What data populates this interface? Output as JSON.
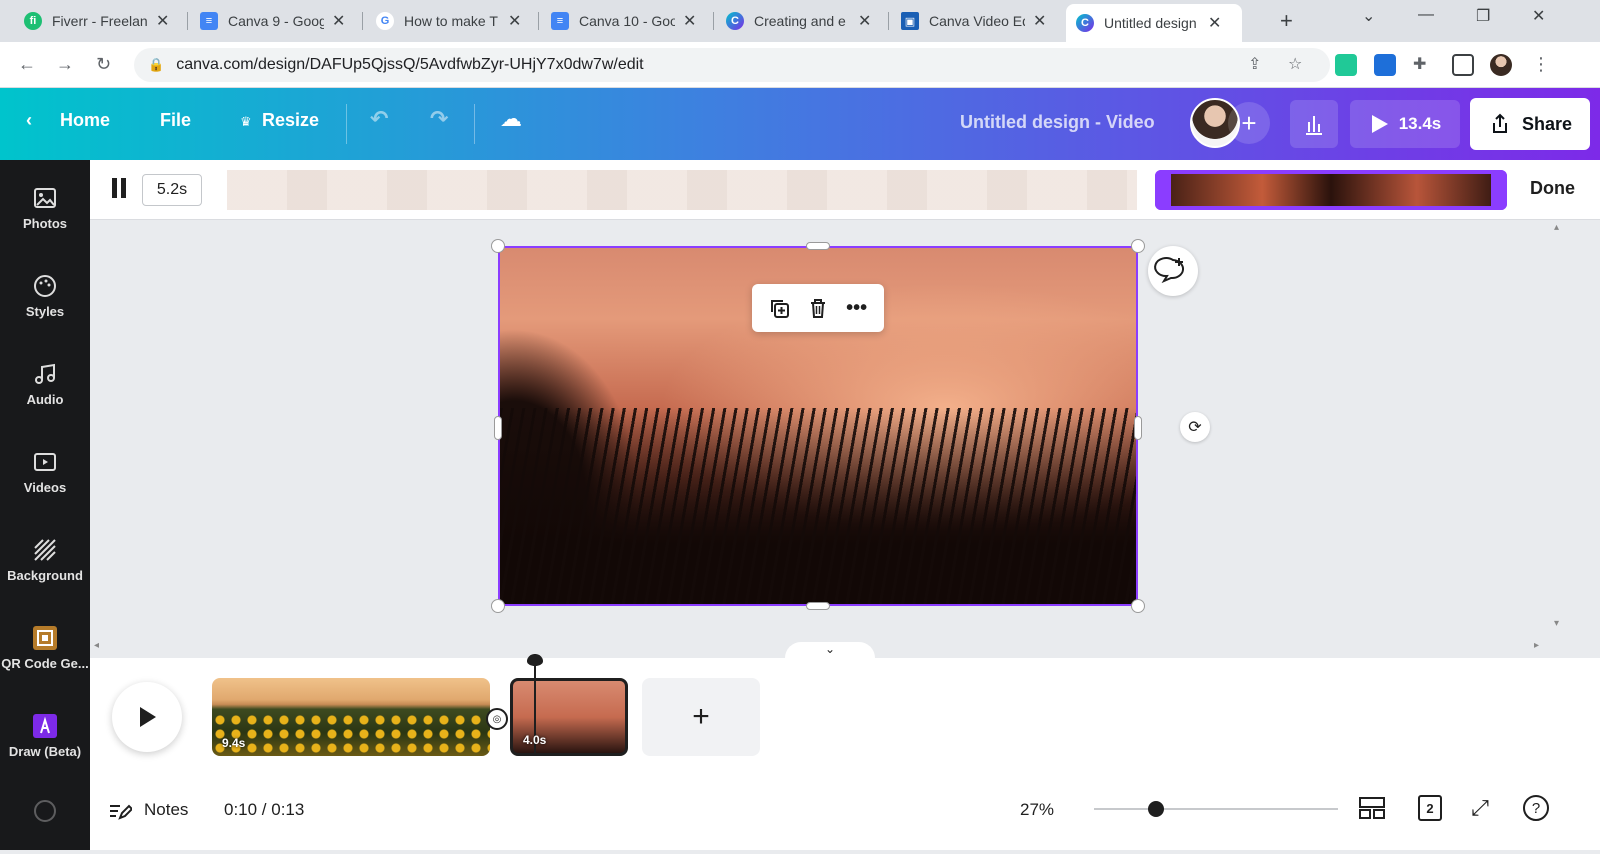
{
  "browser": {
    "tabs": [
      {
        "title": "Fiverr - Freelance",
        "color": "#1dbf73",
        "glyph": "fi"
      },
      {
        "title": "Canva 9 - Google",
        "color": "#4285f4",
        "glyph": "≡"
      },
      {
        "title": "How to make T",
        "color": "#ffffff",
        "glyph": "G"
      },
      {
        "title": "Canva 10 - Goo",
        "color": "#4285f4",
        "glyph": "≡"
      },
      {
        "title": "Creating and e",
        "color": "#7d2ae8",
        "glyph": "C"
      },
      {
        "title": "Canva Video Ed",
        "color": "#1a5fb4",
        "glyph": "▣"
      },
      {
        "title": "Untitled design",
        "color": "#7d2ae8",
        "glyph": "C"
      }
    ],
    "url": "canva.com/design/DAFUp5QjssQ/5AvdfwbZyr-UHjY7x0dw7w/edit"
  },
  "toolbar": {
    "home": "Home",
    "file": "File",
    "resize": "Resize",
    "design_title": "Untitled design - Video",
    "play_duration": "13.4s",
    "share": "Share"
  },
  "sidebar": {
    "items": [
      {
        "label": "Photos"
      },
      {
        "label": "Styles"
      },
      {
        "label": "Audio"
      },
      {
        "label": "Videos"
      },
      {
        "label": "Background"
      },
      {
        "label": "QR Code Ge..."
      },
      {
        "label": "Draw (Beta)"
      }
    ]
  },
  "trim": {
    "duration": "5.2s",
    "done": "Done"
  },
  "timeline": {
    "clips": [
      {
        "duration": "9.4s"
      },
      {
        "duration": "4.0s"
      }
    ],
    "add": "+"
  },
  "status": {
    "notes": "Notes",
    "time": "0:10 / 0:13",
    "zoom": "27%",
    "zoom_value": 27,
    "page_count": "2"
  }
}
